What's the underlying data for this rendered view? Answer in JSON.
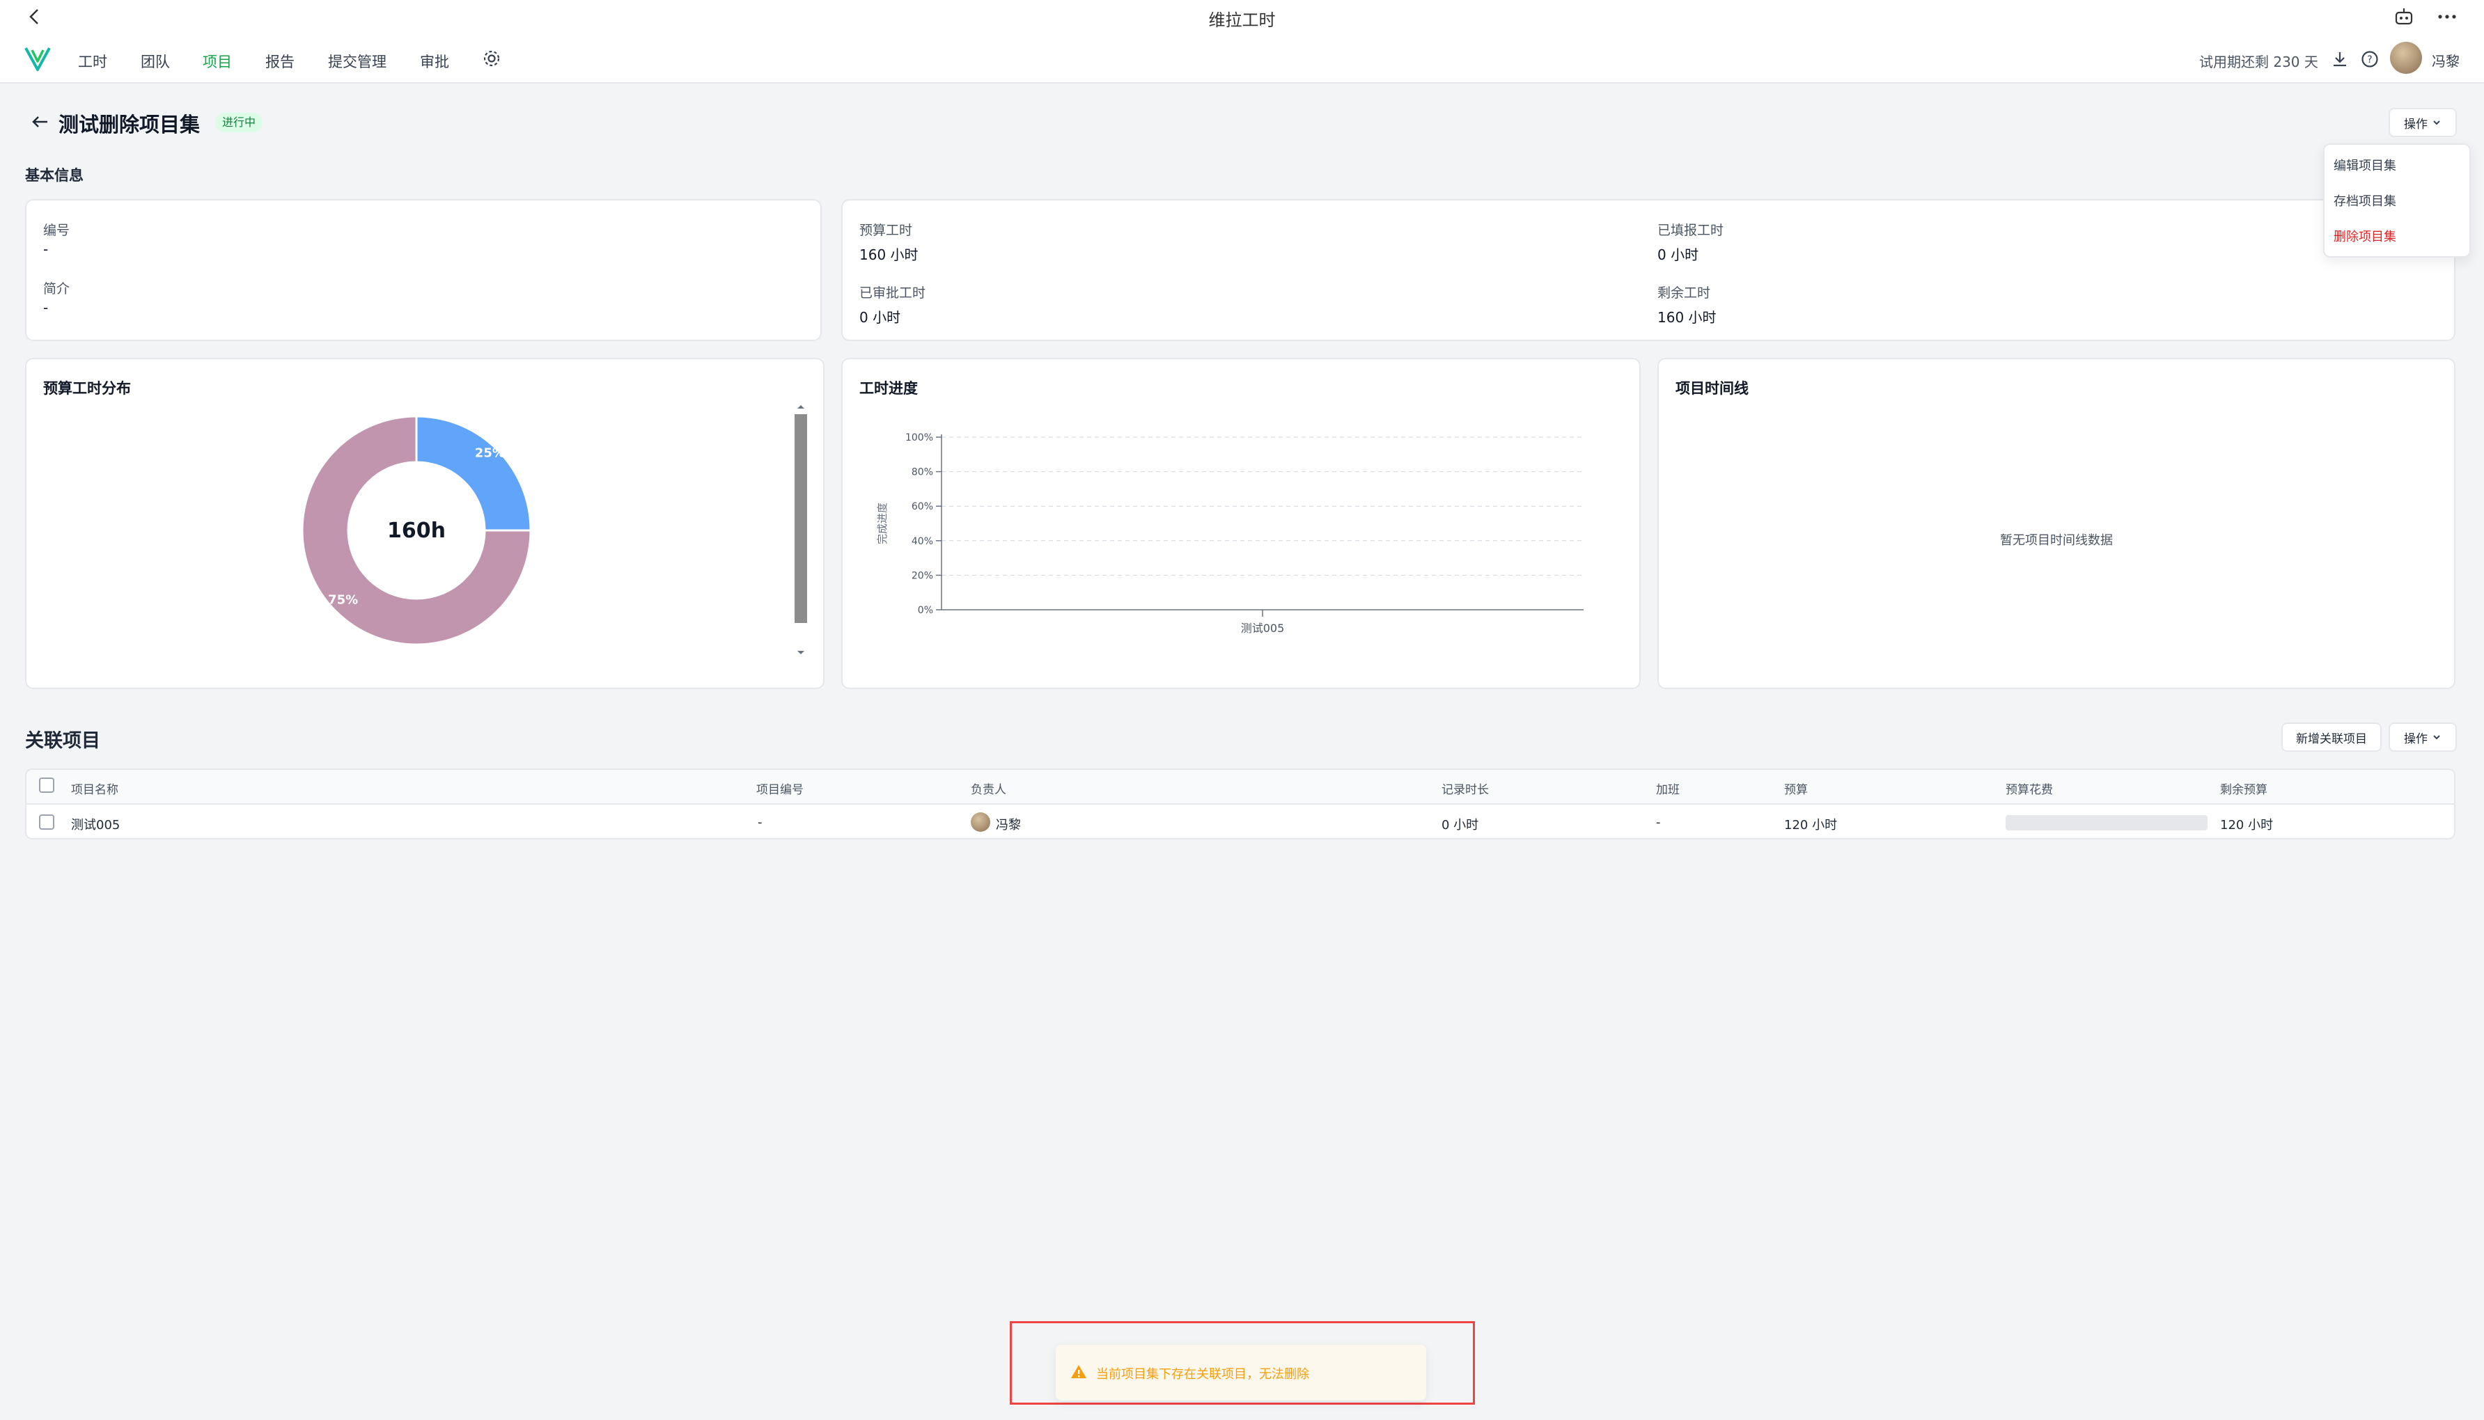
{
  "window": {
    "title": "维拉工时"
  },
  "nav": {
    "items": [
      "工时",
      "团队",
      "项目",
      "报告",
      "提交管理",
      "审批"
    ],
    "active_index": 2,
    "trial_text": "试用期还剩 230 天",
    "user_name": "冯黎"
  },
  "header": {
    "back_icon": "arrow-left-icon",
    "title": "测试删除项目集",
    "status": "进行中",
    "status_color": "#16a34a",
    "action_button": "操作"
  },
  "dropdown": {
    "items": [
      "编辑项目集",
      "存档项目集",
      "删除项目集"
    ],
    "danger_color": "#dc2626"
  },
  "basic_info": {
    "section_title": "基本信息",
    "code_label": "编号",
    "code_value": "-",
    "intro_label": "简介",
    "intro_value": "-"
  },
  "stats": {
    "budget_label": "预算工时",
    "budget_value": "160 小时",
    "filled_label": "已填报工时",
    "filled_value": "0 小时",
    "approved_label": "已审批工时",
    "approved_value": "0 小时",
    "remaining_label": "剩余工时",
    "remaining_value": "160 小时"
  },
  "charts": {
    "budget_dist_title": "预算工时分布",
    "progress_title": "工时进度",
    "timeline_title": "项目时间线",
    "timeline_empty": "暂无项目时间线数据"
  },
  "chart_data": [
    {
      "type": "pie",
      "title": "预算工时分布",
      "center_label": "160h",
      "slices": [
        {
          "label": "25%",
          "value": 25,
          "color": "#60a5fa"
        },
        {
          "label": "75%",
          "value": 75,
          "color": "#c295ae"
        }
      ]
    },
    {
      "type": "bar",
      "title": "工时进度",
      "ylabel": "完成进度",
      "categories": [
        "测试005"
      ],
      "values": [
        0
      ],
      "ylim": [
        0,
        100
      ],
      "yticks": [
        "0%",
        "20%",
        "40%",
        "60%",
        "80%",
        "100%"
      ]
    }
  ],
  "related": {
    "title": "关联项目",
    "add_button": "新增关联项目",
    "action_button": "操作",
    "columns": [
      "项目名称",
      "项目编号",
      "负责人",
      "记录时长",
      "加班",
      "预算",
      "预算花费",
      "剩余预算"
    ],
    "rows": [
      {
        "name": "测试005",
        "code": "-",
        "owner": "冯黎",
        "recorded": "0 小时",
        "overtime": "-",
        "budget": "120 小时",
        "spent_fraction": 0,
        "remaining": "120 小时"
      }
    ]
  },
  "toast": {
    "message": "当前项目集下存在关联项目，无法删除",
    "color": "#f59e0b"
  }
}
